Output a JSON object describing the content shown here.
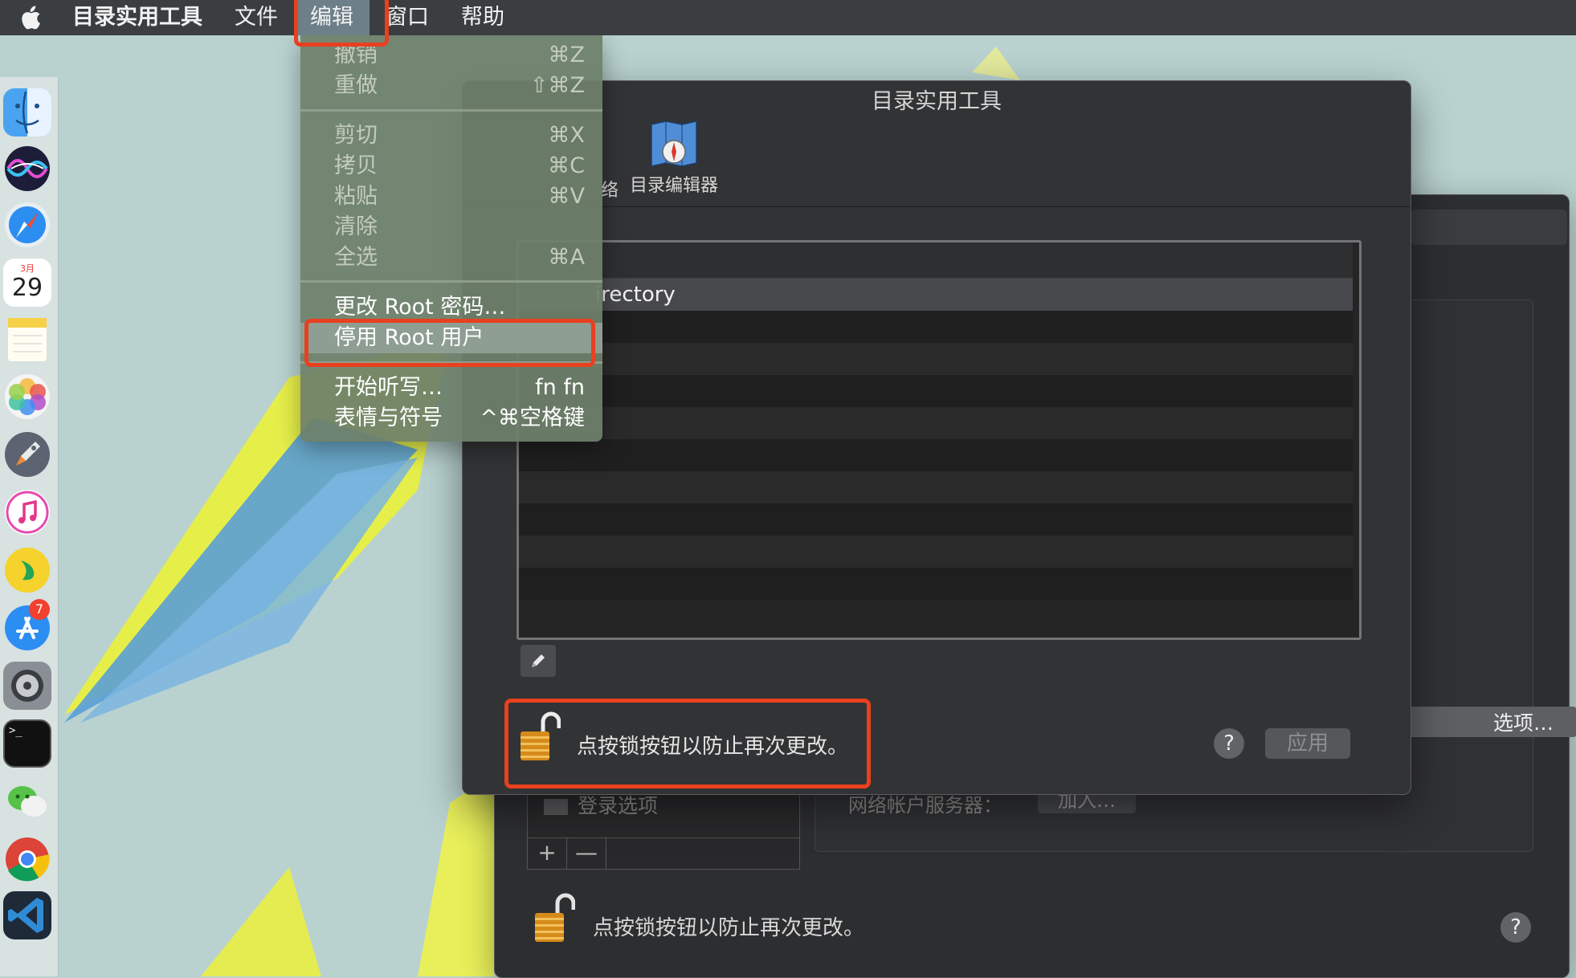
{
  "menubar": {
    "app_name": "目录实用工具",
    "menus": [
      "文件",
      "编辑",
      "窗口",
      "帮助"
    ],
    "active_menu": "编辑"
  },
  "edit_menu": {
    "items": [
      {
        "label": "撤销",
        "shortcut": "⌘Z",
        "enabled": false
      },
      {
        "label": "重做",
        "shortcut": "⇧⌘Z",
        "enabled": false
      },
      {
        "label": "剪切",
        "shortcut": "⌘X",
        "enabled": false
      },
      {
        "label": "拷贝",
        "shortcut": "⌘C",
        "enabled": false
      },
      {
        "label": "粘贴",
        "shortcut": "⌘V",
        "enabled": false
      },
      {
        "label": "清除",
        "shortcut": "",
        "enabled": false
      },
      {
        "label": "全选",
        "shortcut": "⌘A",
        "enabled": false
      },
      {
        "label": "更改 Root 密码…",
        "shortcut": "",
        "enabled": true
      },
      {
        "label": "停用 Root 用户",
        "shortcut": "",
        "enabled": true,
        "highlighted": true
      },
      {
        "label": "开始听写…",
        "shortcut": "fn fn",
        "enabled": true
      },
      {
        "label": "表情与符号",
        "shortcut": "^⌘空格键",
        "enabled": true
      }
    ]
  },
  "main_window": {
    "title": "目录实用工具",
    "toolbar": {
      "partial_item_label": "络",
      "directory_editor_label": "目录编辑器"
    },
    "services_table": {
      "selected_row": "irectory",
      "row_count": 10
    },
    "lock_message": "点按锁按钮以防止再次更改。",
    "help_label": "?",
    "apply_button": "应用"
  },
  "back_window": {
    "options_button": "选项…",
    "login_options_label": "登录选项",
    "network_account_server_label": "网络帐户服务器：",
    "join_button": "加入…",
    "add_label": "+",
    "remove_label": "—",
    "lock_message": "点按锁按钮以防止再次更改。",
    "help_label": "?"
  },
  "dock": {
    "apps": [
      "finder-icon",
      "siri-icon",
      "safari-icon",
      "calendar-icon",
      "notes-icon",
      "photos-icon",
      "launchpad-icon",
      "itunes-icon",
      "qqmusic-icon",
      "app-store-icon",
      "system-preferences-icon",
      "terminal-icon",
      "wechat-icon",
      "chrome-icon",
      "vscode-icon"
    ],
    "calendar_month": "3月",
    "calendar_day": "29",
    "app_store_badge": "7",
    "terminal_prompt": ">_"
  },
  "colors": {
    "highlight_outline": "#e9401f",
    "menu_background": "#6e806a",
    "window_background": "#323335"
  }
}
